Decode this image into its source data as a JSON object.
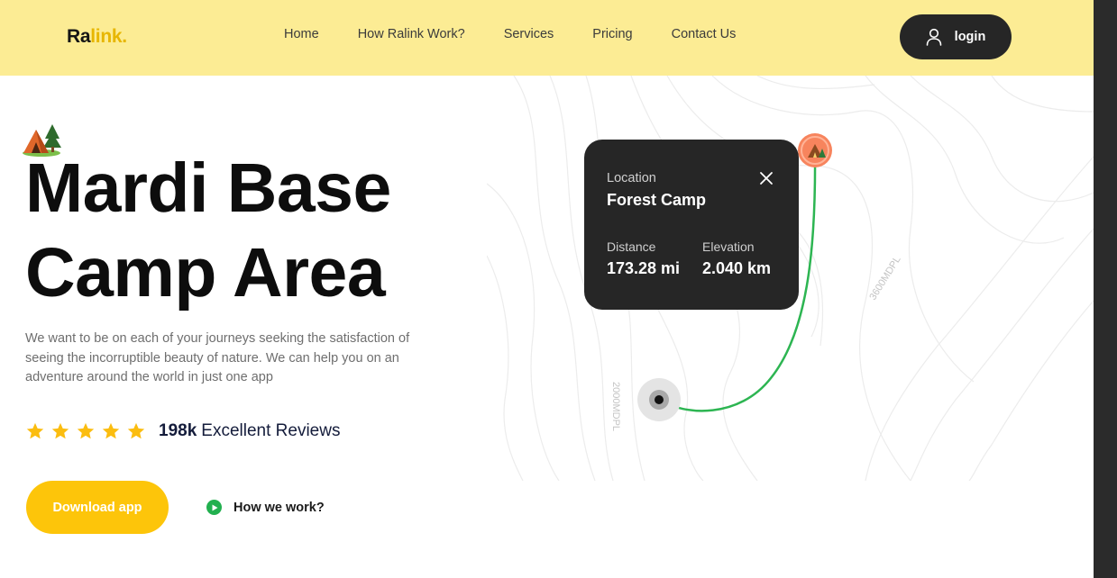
{
  "header": {
    "logo_part1": "Ra",
    "logo_part2": "link.",
    "nav": [
      "Home",
      "How Ralink Work?",
      "Services",
      "Pricing",
      "Contact Us"
    ],
    "login_label": "login",
    "login_icon": "user-icon"
  },
  "hero": {
    "title_line1": "Mardi Base",
    "title_line2": "Camp Area",
    "description": "We want to be on each of your journeys seeking the satisfaction of seeing the incorruptible beauty of nature. We can help you on an adventure around the world in just one app",
    "rating_stars": 5,
    "review_count": "198k",
    "review_label": "Excellent Reviews",
    "download_label": "Download app",
    "how_label": "How we work?",
    "tent_icon": "camping-tent-icon"
  },
  "map": {
    "contour_label_1": "2000MDPL",
    "contour_label_2": "3600MDPL",
    "popup": {
      "location_label": "Location",
      "location_value": "Forest Camp",
      "distance_label": "Distance",
      "distance_value": "173.28 mi",
      "elevation_label": "Elevation",
      "elevation_value": "2.040 km"
    }
  },
  "colors": {
    "header_bg": "#fcec94",
    "accent_yellow": "#fdc50a",
    "route_green": "#2db552",
    "pin_orange": "#f7845d",
    "dark": "#262626"
  }
}
